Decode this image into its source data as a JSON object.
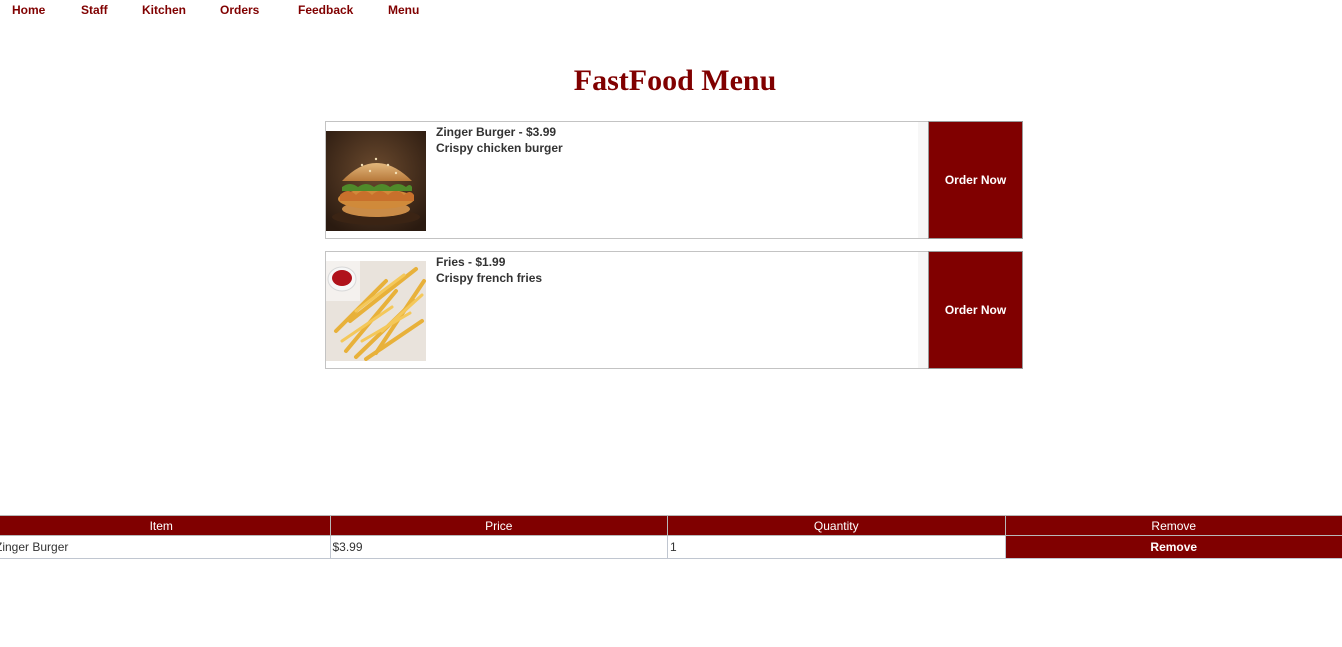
{
  "nav": {
    "items": [
      "Home",
      "Staff",
      "Kitchen",
      "Orders",
      "Feedback",
      "Menu"
    ]
  },
  "page": {
    "title": "FastFood Menu"
  },
  "menu": {
    "items": [
      {
        "name_price": "Zinger Burger - $3.99",
        "description": "Crispy chicken burger",
        "image": "zinger-burger-photo",
        "button_label": "Order Now"
      },
      {
        "name_price": "Fries - $1.99",
        "description": "Crispy french fries",
        "image": "fries-photo",
        "button_label": "Order Now"
      }
    ]
  },
  "cart": {
    "headers": [
      "Item",
      "Price",
      "Quantity",
      "Remove"
    ],
    "rows": [
      {
        "item": "Zinger Burger",
        "price": "$3.99",
        "quantity": "1",
        "remove_label": "Remove"
      }
    ]
  },
  "colors": {
    "brand": "#800000",
    "text": "#333333",
    "border": "#c3c3c3"
  }
}
